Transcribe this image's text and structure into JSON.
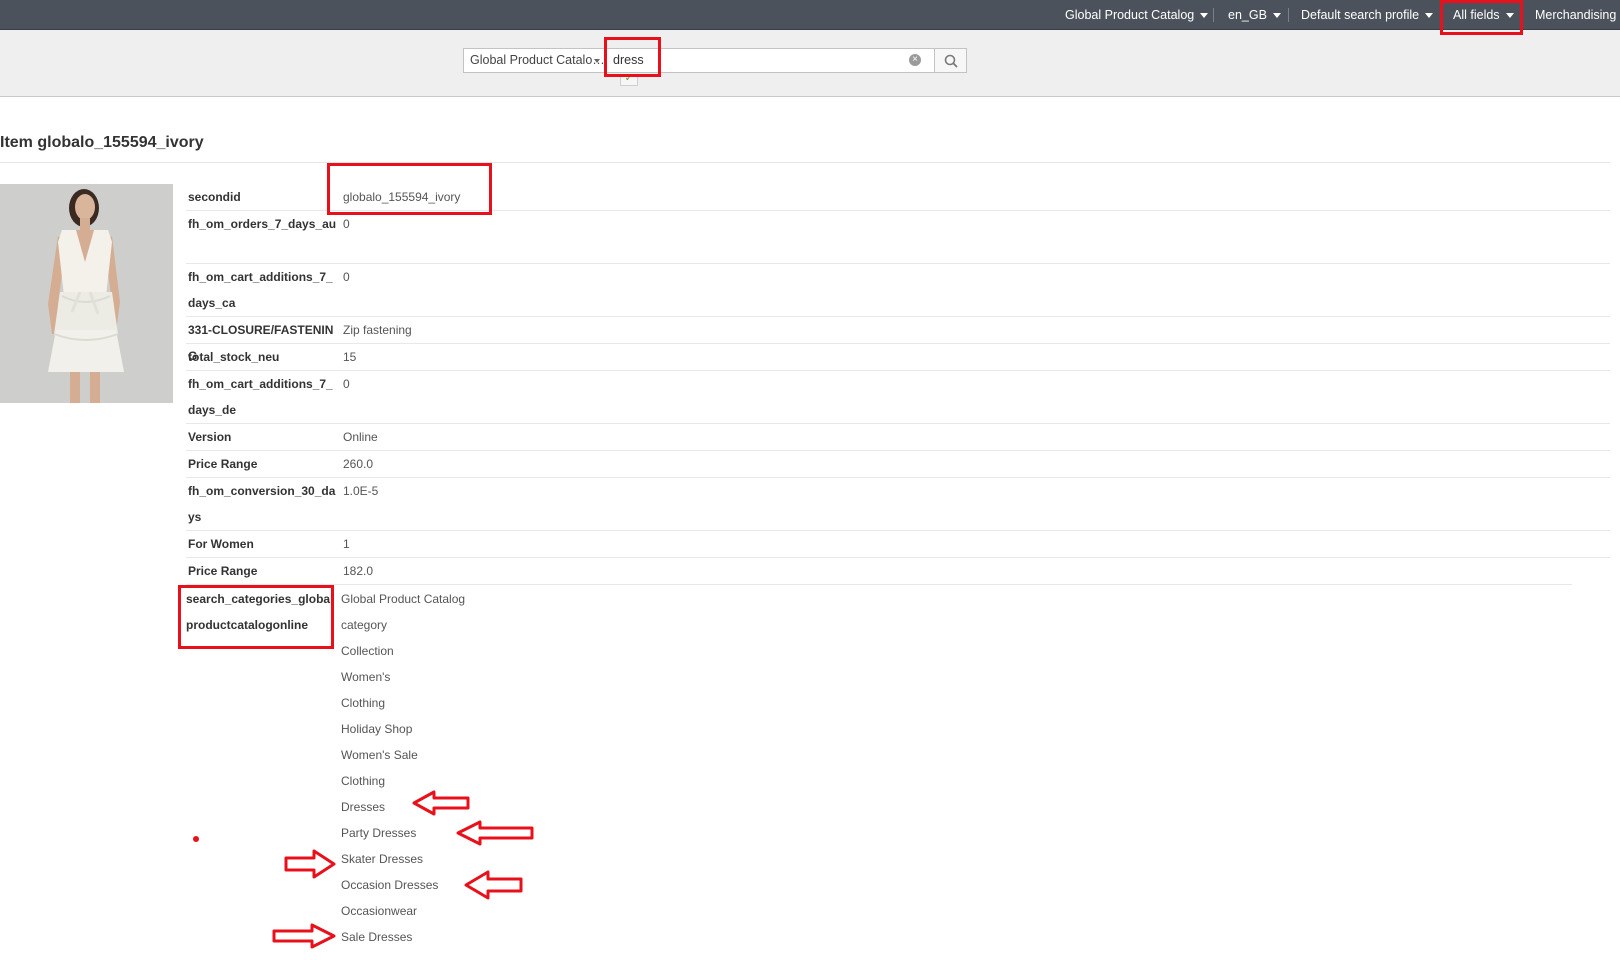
{
  "topbar": {
    "catalog": "Global Product Catalog",
    "locale": "en_GB",
    "search_profile": "Default search profile",
    "fields": "All fields",
    "merchandising": "Merchandising"
  },
  "search": {
    "catalog_select": "Global Product Catalo…",
    "query": "dress"
  },
  "item": {
    "title": "Item globalo_155594_ivory",
    "fields": [
      {
        "key": "secondid",
        "value": "globalo_155594_ivory"
      },
      {
        "key": "fh_om_orders_7_days_au",
        "value": "0"
      },
      {
        "key": "fh_om_cart_additions_7_days_ca",
        "value": "0"
      },
      {
        "key": "331-CLOSURE/FASTENING",
        "value": "Zip fastening"
      },
      {
        "key": "total_stock_neu",
        "value": "15"
      },
      {
        "key": "fh_om_cart_additions_7_days_de",
        "value": "0"
      },
      {
        "key": "Version",
        "value": "Online"
      },
      {
        "key": "Price Range",
        "value": "260.0"
      },
      {
        "key": "fh_om_conversion_30_days",
        "value": "1.0E-5"
      },
      {
        "key": "For Women",
        "value": "1"
      },
      {
        "key": "Price Range",
        "value": "182.0"
      }
    ],
    "categories_key": "search_categories_globalproductcatalogonline",
    "categories": [
      "Global Product Catalog",
      "category",
      "Collection",
      "Women's",
      "Clothing",
      "Holiday Shop",
      "Women's Sale",
      "Clothing",
      "Dresses",
      "Party Dresses",
      "Skater Dresses",
      "Occasion Dresses",
      "Occasionwear",
      "Sale Dresses"
    ]
  },
  "colors": {
    "topbar_bg": "#4b525b",
    "highlight_red": "#e8101a",
    "searchbar_bg": "#efefef"
  }
}
